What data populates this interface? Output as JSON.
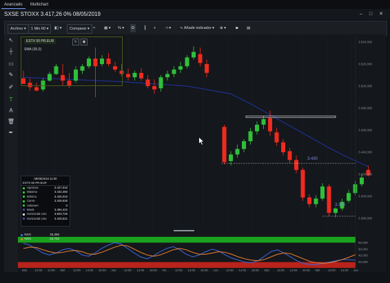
{
  "tabs": [
    {
      "label": "Avanzado",
      "active": true
    },
    {
      "label": "Multichart",
      "active": false
    }
  ],
  "window_title": "SXSE STOXX 3.417,26 0% 08/05/2019",
  "toolbar": {
    "file_label": "Archivo",
    "interval_label": "1 Min 60",
    "compare_label": "Comparar",
    "scale_percent_label": "%",
    "drawing_label": "D",
    "add_indicator_label": "Añadir indicador"
  },
  "left_tools": [
    "cursor-icon",
    "crosshair-icon",
    "rectangle-icon",
    "brush-icon",
    "pencil-icon",
    "text-icon",
    "font-icon",
    "trash-icon",
    "eyedropper-icon"
  ],
  "info_box": {
    "symbol": "ESTX 50 PR.EUR",
    "sma_label": "SMA (35,0)"
  },
  "data_panel": {
    "datetime": "08/05/2019 11:00",
    "symbol": "ESTX 50 PR.EUR",
    "rows": [
      {
        "label": "Apertura",
        "value": "3.427,010",
        "color": "#2fbf3a"
      },
      {
        "label": "Máximo",
        "value": "3.432,460",
        "color": "#2fbf3a"
      },
      {
        "label": "Mínimo",
        "value": "3.426,010",
        "color": "#2fbf3a"
      },
      {
        "label": "Cierre",
        "value": "3.429,630",
        "color": "#2fbf3a"
      },
      {
        "label": "Volumen",
        "value": "0",
        "color": "#2fbf3a"
      },
      {
        "label": "Mov5",
        "value": "3.494,422",
        "color": "#3b4a9e"
      },
      {
        "label": "Horizontal Line",
        "value": "3.503,725",
        "color": "#cfd3d8"
      },
      {
        "label": "Horizontal Line",
        "value": "3.429,521",
        "color": "#3b4a9e"
      }
    ]
  },
  "lower_legend": [
    {
      "name": "%KS",
      "value": "26,356",
      "color": "#3b63d9"
    },
    {
      "name": "%DS",
      "value": "42,722",
      "color": "#e07a30"
    }
  ],
  "colors": {
    "up": "#2fbf3a",
    "down": "#f02a1f",
    "sma": "#1f2f8f",
    "osc_k": "#3b63d9",
    "osc_d": "#e07a30",
    "overbought": "#1ba21f",
    "oversold": "#b8231b"
  },
  "chart_data": [
    {
      "type": "candlestick",
      "title": "",
      "ylim": [
        3372,
        3545
      ],
      "y_ticks": [
        "3.540,000",
        "3.520,000",
        "3.500,000",
        "3.480,000",
        "3.460,000",
        "3.440,000",
        "3.420,000",
        "3.400,000",
        "3.380,000"
      ],
      "x_ticks": [
        "Mar",
        "12:00",
        "14:00",
        "Mié",
        "12:00",
        "14:00",
        "16:00",
        "Jue",
        "12:00",
        "14:00",
        "16:00",
        "Vie",
        "12:00",
        "14:00",
        "16:00",
        "Lun",
        "12:00",
        "14:00",
        "16:00",
        "Mar",
        "12:00",
        "14:00",
        "16:00",
        "Mié",
        "12:00",
        "14:00",
        "Jue"
      ],
      "annotations": [
        {
          "text": "3.430",
          "y": 3430
        },
        {
          "text": "3.390",
          "y": 3390
        }
      ],
      "candles": [
        [
          3507,
          3514,
          3504,
          3502
        ],
        [
          3503,
          3507,
          3496,
          3499
        ],
        [
          3499,
          3503,
          3495,
          3496
        ],
        [
          3497,
          3507,
          3495,
          3505
        ],
        [
          3505,
          3513,
          3504,
          3511
        ],
        [
          3511,
          3520,
          3510,
          3518
        ],
        [
          3510,
          3520,
          3500,
          3505
        ],
        [
          3505,
          3512,
          3498,
          3500
        ],
        [
          3505,
          3518,
          3503,
          3515
        ],
        [
          3514,
          3520,
          3511,
          3518
        ],
        [
          3518,
          3527,
          3516,
          3525
        ],
        [
          3525,
          3535,
          3490,
          3518
        ],
        [
          3520,
          3528,
          3518,
          3525
        ],
        [
          3525,
          3530,
          3518,
          3520
        ],
        [
          3518,
          3522,
          3513,
          3515
        ],
        [
          3514,
          3520,
          3509,
          3511
        ],
        [
          3511,
          3516,
          3505,
          3508
        ],
        [
          3508,
          3514,
          3505,
          3512
        ],
        [
          3512,
          3516,
          3505,
          3507
        ],
        [
          3506,
          3510,
          3498,
          3500
        ],
        [
          3500,
          3506,
          3493,
          3497
        ],
        [
          3498,
          3510,
          3495,
          3508
        ],
        [
          3508,
          3514,
          3505,
          3511
        ],
        [
          3511,
          3518,
          3508,
          3515
        ],
        [
          3515,
          3522,
          3512,
          3518
        ],
        [
          3518,
          3528,
          3516,
          3526
        ],
        [
          3526,
          3536,
          3524,
          3531
        ],
        [
          3529,
          3535,
          3518,
          3521
        ],
        [
          3520,
          3524,
          3508,
          3512
        ],
        [
          3463,
          3465,
          3429,
          3431
        ],
        [
          3432,
          3441,
          3428,
          3438
        ],
        [
          3438,
          3447,
          3435,
          3443
        ],
        [
          3443,
          3452,
          3440,
          3450
        ],
        [
          3450,
          3462,
          3447,
          3459
        ],
        [
          3459,
          3468,
          3456,
          3465
        ],
        [
          3465,
          3473,
          3461,
          3470
        ],
        [
          3471,
          3478,
          3455,
          3459
        ],
        [
          3458,
          3462,
          3446,
          3449
        ],
        [
          3449,
          3452,
          3437,
          3440
        ],
        [
          3441,
          3444,
          3430,
          3433
        ],
        [
          3433,
          3437,
          3421,
          3424
        ],
        [
          3424,
          3426,
          3396,
          3399
        ],
        [
          3399,
          3402,
          3390,
          3393
        ],
        [
          3393,
          3401,
          3390,
          3398
        ],
        [
          3398,
          3412,
          3396,
          3409
        ],
        [
          3409,
          3411,
          3382,
          3385
        ],
        [
          3385,
          3390,
          3381,
          3389
        ],
        [
          3389,
          3398,
          3387,
          3395
        ],
        [
          3396,
          3406,
          3394,
          3403
        ],
        [
          3403,
          3414,
          3401,
          3411
        ],
        [
          3411,
          3420,
          3409,
          3417
        ],
        [
          3424,
          3428,
          3418,
          3419
        ]
      ],
      "sma": [
        [
          0,
          3508
        ],
        [
          15,
          3504
        ],
        [
          25,
          3500
        ],
        [
          30,
          3493
        ],
        [
          33,
          3484
        ],
        [
          36,
          3474
        ],
        [
          39,
          3464
        ],
        [
          42,
          3454
        ],
        [
          45,
          3444
        ],
        [
          48,
          3435
        ],
        [
          51,
          3427
        ]
      ]
    },
    {
      "type": "line",
      "title": "",
      "ylim": [
        0,
        100
      ],
      "y_ticks": [
        "80,000",
        "60,000",
        "40,000",
        "20,000"
      ],
      "overbought": 80,
      "oversold": 20,
      "series": [
        {
          "name": "%KS",
          "values": [
            78,
            72,
            60,
            48,
            42,
            48,
            58,
            62,
            55,
            42,
            38,
            48,
            62,
            72,
            80,
            76,
            62,
            48,
            36,
            30,
            40,
            52,
            62,
            68,
            58,
            44,
            36,
            42,
            52,
            60,
            54,
            42,
            32,
            26,
            20,
            18,
            24,
            38,
            52,
            58,
            48,
            36,
            24,
            16,
            12,
            12,
            16,
            20,
            24,
            28,
            27,
            26
          ]
        },
        {
          "name": "%DS",
          "values": [
            62,
            66,
            65,
            58,
            52,
            48,
            50,
            54,
            56,
            52,
            45,
            44,
            50,
            58,
            66,
            72,
            70,
            60,
            50,
            42,
            38,
            42,
            50,
            58,
            62,
            58,
            50,
            44,
            44,
            48,
            52,
            50,
            44,
            36,
            30,
            26,
            24,
            28,
            36,
            44,
            48,
            46,
            38,
            30,
            22,
            18,
            16,
            18,
            22,
            28,
            35,
            43
          ]
        }
      ]
    }
  ]
}
